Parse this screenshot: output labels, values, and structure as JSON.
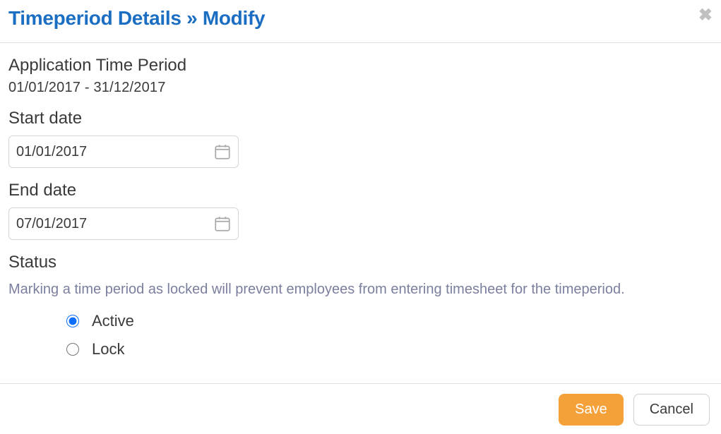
{
  "header": {
    "title": "Timeperiod Details » Modify"
  },
  "body": {
    "app_period_label": "Application Time Period",
    "app_period_range": "01/01/2017 - 31/12/2017",
    "start_date_label": "Start date",
    "start_date_value": "01/01/2017",
    "end_date_label": "End date",
    "end_date_value": "07/01/2017",
    "status_label": "Status",
    "status_help": "Marking a time period as locked will prevent employees from entering timesheet for the timeperiod.",
    "status_options": {
      "active": "Active",
      "lock": "Lock"
    },
    "status_selected": "active"
  },
  "footer": {
    "save_label": "Save",
    "cancel_label": "Cancel"
  }
}
